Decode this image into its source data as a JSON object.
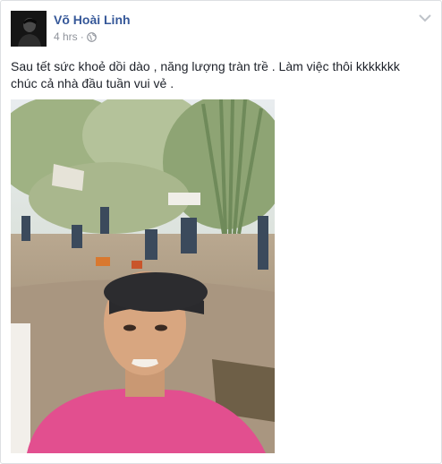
{
  "post": {
    "author": "Võ Hoài Linh",
    "timestamp": "4 hrs",
    "separator": "·",
    "audience_icon": "globe-icon",
    "menu_icon": "chevron-down-icon",
    "text_line1": "Sau tết sức khoẻ dồi dào , năng lượng tràn trề . Làm việc thôi kkkkkkk",
    "text_line2": "chúc cả nhà đầu tuần vui vẻ ."
  },
  "colors": {
    "author_link": "#365899",
    "meta_text": "#90949c",
    "body_text": "#1d2129",
    "border": "#dddfe2"
  }
}
